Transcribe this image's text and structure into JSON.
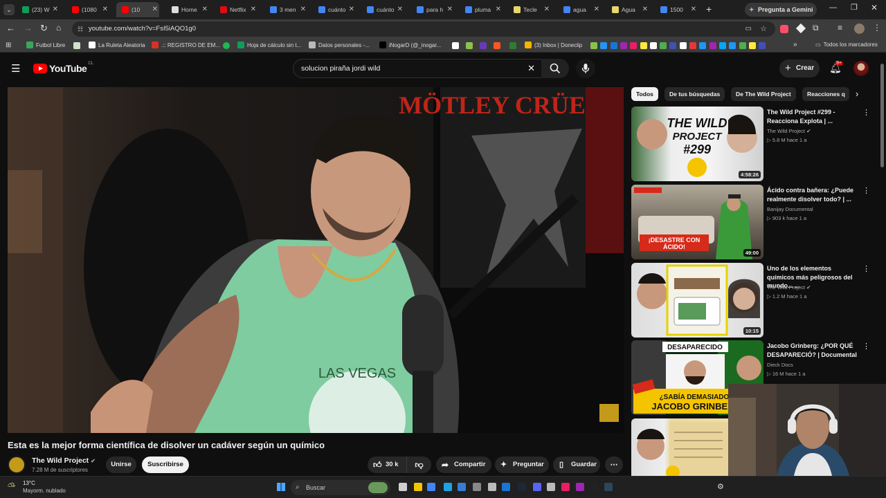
{
  "browser": {
    "tabs": [
      {
        "label": "(23) W",
        "color": "#0f9d58"
      },
      {
        "label": "(1080",
        "color": "#ff0000"
      },
      {
        "label": "(10",
        "color": "#ff0000"
      },
      {
        "label": "Home",
        "color": "#dddddd"
      },
      {
        "label": "Netflix",
        "color": "#e50914"
      },
      {
        "label": "3 men",
        "color": "#4285f4"
      },
      {
        "label": "cuánto",
        "color": "#4285f4"
      },
      {
        "label": "cuánto",
        "color": "#4285f4"
      },
      {
        "label": "para h",
        "color": "#4285f4"
      },
      {
        "label": "pluma",
        "color": "#4285f4"
      },
      {
        "label": "Tecle",
        "color": "#e6d86a"
      },
      {
        "label": "agua",
        "color": "#4285f4"
      },
      {
        "label": "Agua",
        "color": "#e6d86a"
      },
      {
        "label": "1500",
        "color": "#4285f4"
      }
    ],
    "gemini_label": "Pregunta a Gemini",
    "url": "youtube.com/watch?v=FsI5iAQO1g0",
    "bookmarks": [
      {
        "label": "Futbol Libre",
        "color": "#3aa757"
      },
      {
        "label": "La Ruleta Aleatoria",
        "color": "#ffffff"
      },
      {
        "label": ".:: REGISTRO DE EM...",
        "color": "#d93025"
      },
      {
        "label": "Hoja de cálculo sin t...",
        "color": "#0f9d58"
      },
      {
        "label": "Datos personales -...",
        "color": "#bbbbbb"
      },
      {
        "label": "iNogarD (@_inogar...",
        "color": "#000000"
      },
      {
        "label": "(3) Inbox | Doneclip",
        "color": "#f4b400"
      }
    ],
    "all_bookmarks_label": "Todos los marcadores"
  },
  "youtube": {
    "logo_text": "YouTube",
    "country_code": "CL",
    "search_value": "solucion piraña jordi wild",
    "create_label": "Crear",
    "notif_count": "9+"
  },
  "video": {
    "title": "Esta es la mejor forma científica de disolver un cadáver según un químico",
    "channel": "The Wild Project",
    "subscribers": "7.28 M de suscriptores",
    "join_label": "Unirse",
    "subscribe_label": "Suscribirse",
    "likes": "30 k",
    "share_label": "Compartir",
    "ask_label": "Preguntar",
    "save_label": "Guardar",
    "overlay_text_1": "MÖTLEY CRÜE",
    "overlay_text_2": "LAS VEGAS"
  },
  "chips": [
    {
      "label": "Todos",
      "active": true
    },
    {
      "label": "De tus búsquedas",
      "active": false
    },
    {
      "label": "De The Wild Project",
      "active": false
    },
    {
      "label": "Reacciones q",
      "active": false
    }
  ],
  "recommended": [
    {
      "title": "The Wild Project #299 - Reacciona Explota | ...",
      "channel": "The Wild Project",
      "verified": true,
      "meta": "5.8 M  hace 1 a",
      "duration": "4:58:26",
      "thumb_text": "THE WILD PROJECT #299",
      "thumb_color": "#e8e0d0"
    },
    {
      "title": "Ácido contra bañera: ¿Puede realmente disolver todo? | ...",
      "channel": "Banijay Documental",
      "verified": false,
      "meta": "903 k  hace 1 a",
      "duration": "49:00",
      "thumb_text": "¡DESASTRE CON ÁCIDO!",
      "thumb_color": "#8a8070"
    },
    {
      "title": "Uno de los elementos químicos más peligrosos del mundo... ...",
      "channel": "The Wild Project",
      "verified": true,
      "meta": "1.2 M  hace 1 a",
      "duration": "10:15",
      "thumb_text": "",
      "thumb_color": "#d8d0c0"
    },
    {
      "title": "Jacobo Grinberg: ¿POR QUÉ DESAPARECIÓ? | Documental",
      "channel": "Dieck Docs",
      "verified": false,
      "meta": "16 M  hace 1 a",
      "duration": "",
      "thumb_text": "DESAPARECIDO",
      "thumb_text_2": "¿SABÍA DEMASIADO? JACOBO GRINBERG",
      "thumb_color": "#1a3a1a"
    }
  ],
  "taskbar": {
    "weather_temp": "13°C",
    "weather_desc": "Mayorm. nublado",
    "search_placeholder": "Buscar"
  }
}
